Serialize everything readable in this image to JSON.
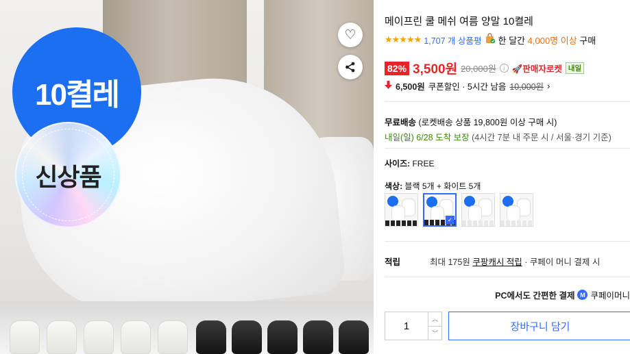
{
  "product": {
    "title": "메이프린 쿨 메쉬 여름 양말 10켤레",
    "image_badges": {
      "count": "10켤레",
      "new": "신상품"
    }
  },
  "rating": {
    "stars": "★★★★★",
    "value": 4.5,
    "review_count": "1,707 개 상품평",
    "monthly_prefix": "한 달간",
    "monthly_buyers": "4,000명 이상",
    "monthly_suffix": "구매"
  },
  "price": {
    "discount": "82%",
    "sale": "3,500원",
    "original": "20,000원",
    "seller_rocket": "판매자로켓",
    "tomorrow_tag": "내일"
  },
  "coupon": {
    "price": "6,500원",
    "label": "쿠폰할인 · 5시간 남음",
    "original": "10,000원",
    "chevron": "›"
  },
  "shipping": {
    "label": "무료배송",
    "detail": "(로켓배송 상품 19,800원 이상 구매 시)",
    "delivery_date": "내일(일) 6/28 도착 보장",
    "delivery_detail": "(4시간 7분 내 주문 시 / 서울·경기 기준)"
  },
  "options": {
    "size_label": "사이즈:",
    "size_value": "FREE",
    "color_label": "색상:",
    "color_value": "블랙 5개 + 화이트 5개",
    "swatches": [
      {
        "name": "swatch-1",
        "selected": false
      },
      {
        "name": "swatch-2",
        "selected": true
      },
      {
        "name": "swatch-3",
        "selected": false
      },
      {
        "name": "swatch-4",
        "selected": false
      }
    ]
  },
  "points": {
    "label": "적립",
    "prefix": "최대 175원",
    "link": "쿠팡캐시 적립",
    "suffix": "· 쿠페이 머니 결제 시"
  },
  "payment": {
    "pc_text": "PC에서도 간편한 결제",
    "coupay_icon": "M",
    "coupay_text": "쿠페이머니"
  },
  "purchase": {
    "quantity": "1",
    "cart_label": "장바구니 담기"
  },
  "icons": {
    "heart": "♡",
    "share": "⋖",
    "bag": "🛍",
    "down_arrow": "🠇",
    "rocket": "🚀",
    "info": "i",
    "up": "︿",
    "down": "﹀",
    "check": "✓"
  },
  "colors": {
    "accent_blue": "#346aff",
    "sale_red": "#e52528",
    "delivery_green": "#3b8a0c",
    "star_orange": "#f5a100"
  }
}
